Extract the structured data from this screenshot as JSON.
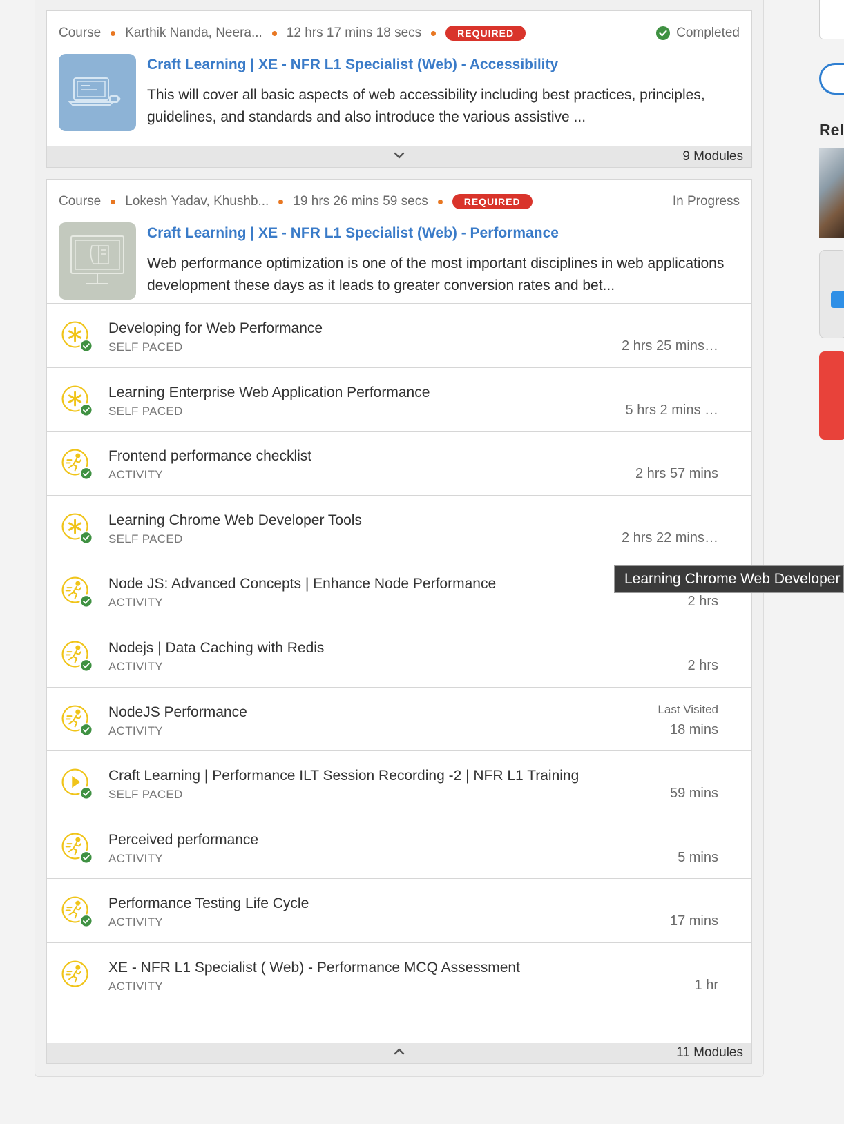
{
  "courses": [
    {
      "type": "Course",
      "authors": "Karthik Nanda, Neera...",
      "duration": "12 hrs 17 mins 18 secs",
      "required": "REQUIRED",
      "status": "Completed",
      "title": "Craft Learning | XE - NFR L1 Specialist (Web) - Accessibility",
      "description": "This will cover all basic aspects of web accessibility including best practices, principles, guidelines, and standards and also introduce the various assistive ...",
      "modules_label": "9 Modules"
    },
    {
      "type": "Course",
      "authors": "Lokesh Yadav, Khushb...",
      "duration": "19 hrs 26 mins 59 secs",
      "required": "REQUIRED",
      "status": "In Progress",
      "title": "Craft Learning | XE - NFR L1 Specialist (Web) - Performance",
      "description": "Web performance optimization is one of the most important disciplines in web applications development these days as it leads to greater conversion rates and bet...",
      "modules_label": "11 Modules"
    }
  ],
  "modules": [
    {
      "title": "Developing for Web Performance",
      "type": "SELF PACED",
      "duration": "2 hrs 25 mins…",
      "icon": "self-paced-icon",
      "completed": true
    },
    {
      "title": "Learning Enterprise Web Application Performance",
      "type": "SELF PACED",
      "duration": "5 hrs 2 mins …",
      "icon": "self-paced-icon",
      "completed": true
    },
    {
      "title": "Frontend performance checklist",
      "type": "ACTIVITY",
      "duration": "2 hrs 57 mins",
      "icon": "activity-runner-icon",
      "completed": true
    },
    {
      "title": "Learning Chrome Web Developer Tools",
      "type": "SELF PACED",
      "duration": "2 hrs 22 mins…",
      "icon": "self-paced-icon",
      "completed": true
    },
    {
      "title": "Node JS: Advanced Concepts | Enhance Node Performance",
      "type": "ACTIVITY",
      "duration": "2 hrs",
      "icon": "activity-runner-icon",
      "completed": true
    },
    {
      "title": "Nodejs | Data Caching with Redis",
      "type": "ACTIVITY",
      "duration": "2 hrs",
      "icon": "activity-runner-icon",
      "completed": true
    },
    {
      "title": "NodeJS Performance",
      "type": "ACTIVITY",
      "duration": "18 mins",
      "last_visited": "Last Visited",
      "icon": "activity-runner-icon",
      "completed": true
    },
    {
      "title": "Craft Learning | Performance ILT Session Recording -2 | NFR L1 Training",
      "type": "SELF PACED",
      "duration": "59 mins",
      "icon": "video-play-icon",
      "completed": true
    },
    {
      "title": "Perceived performance",
      "type": "ACTIVITY",
      "duration": "5 mins",
      "icon": "activity-runner-icon",
      "completed": true
    },
    {
      "title": "Performance Testing Life Cycle",
      "type": "ACTIVITY",
      "duration": "17 mins",
      "icon": "activity-runner-icon",
      "completed": true
    },
    {
      "title": "XE - NFR L1 Specialist ( Web) - Performance MCQ Assessment",
      "type": "ACTIVITY",
      "duration": "1 hr",
      "icon": "activity-runner-icon",
      "completed": false
    }
  ],
  "tooltip": "Learning Chrome Web Developer Tools",
  "sidebar": {
    "related_label": "Rel"
  },
  "colors": {
    "accent": "#3a7bc8",
    "required": "#d9342b",
    "success": "#3f9142",
    "icon_yellow": "#f0c419",
    "dot": "#e87722"
  }
}
